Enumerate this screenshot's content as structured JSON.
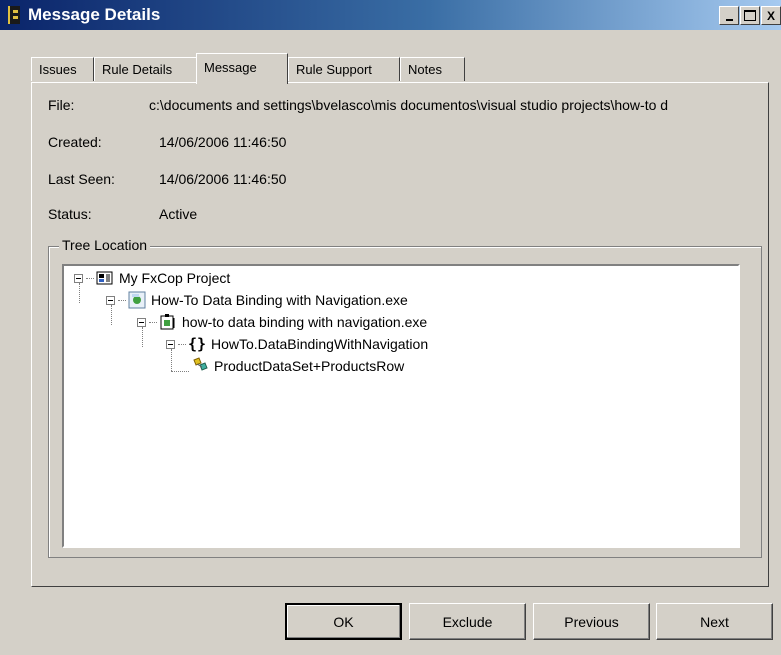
{
  "window": {
    "title": "Message Details",
    "controls": {
      "minimize": "_",
      "maximize": "□",
      "close": "X"
    }
  },
  "tabs": [
    {
      "label": "Issues",
      "active": false
    },
    {
      "label": "Rule Details",
      "active": false
    },
    {
      "label": "Message",
      "active": true
    },
    {
      "label": "Rule Support",
      "active": false
    },
    {
      "label": "Notes",
      "active": false
    }
  ],
  "fields": {
    "file": {
      "label": "File:",
      "value": "c:\\documents and settings\\bvelasco\\mis documentos\\visual studio projects\\how-to d"
    },
    "created": {
      "label": "Created:",
      "value": "14/06/2006 11:46:50"
    },
    "last_seen": {
      "label": "Last Seen:",
      "value": "14/06/2006 11:46:50"
    },
    "status": {
      "label": "Status:",
      "value": "Active"
    }
  },
  "tree_location": {
    "legend": "Tree Location",
    "nodes": [
      {
        "label": "My FxCop Project",
        "icon": "project-icon"
      },
      {
        "label": "How-To Data Binding with Navigation.exe",
        "icon": "target-icon"
      },
      {
        "label": "how-to data binding with navigation.exe",
        "icon": "module-icon"
      },
      {
        "label": "HowTo.DataBindingWithNavigation",
        "icon": "namespace-icon"
      },
      {
        "label": "ProductDataSet+ProductsRow",
        "icon": "type-icon"
      }
    ]
  },
  "buttons": {
    "ok": "OK",
    "exclude": "Exclude",
    "previous": "Previous",
    "next": "Next"
  }
}
